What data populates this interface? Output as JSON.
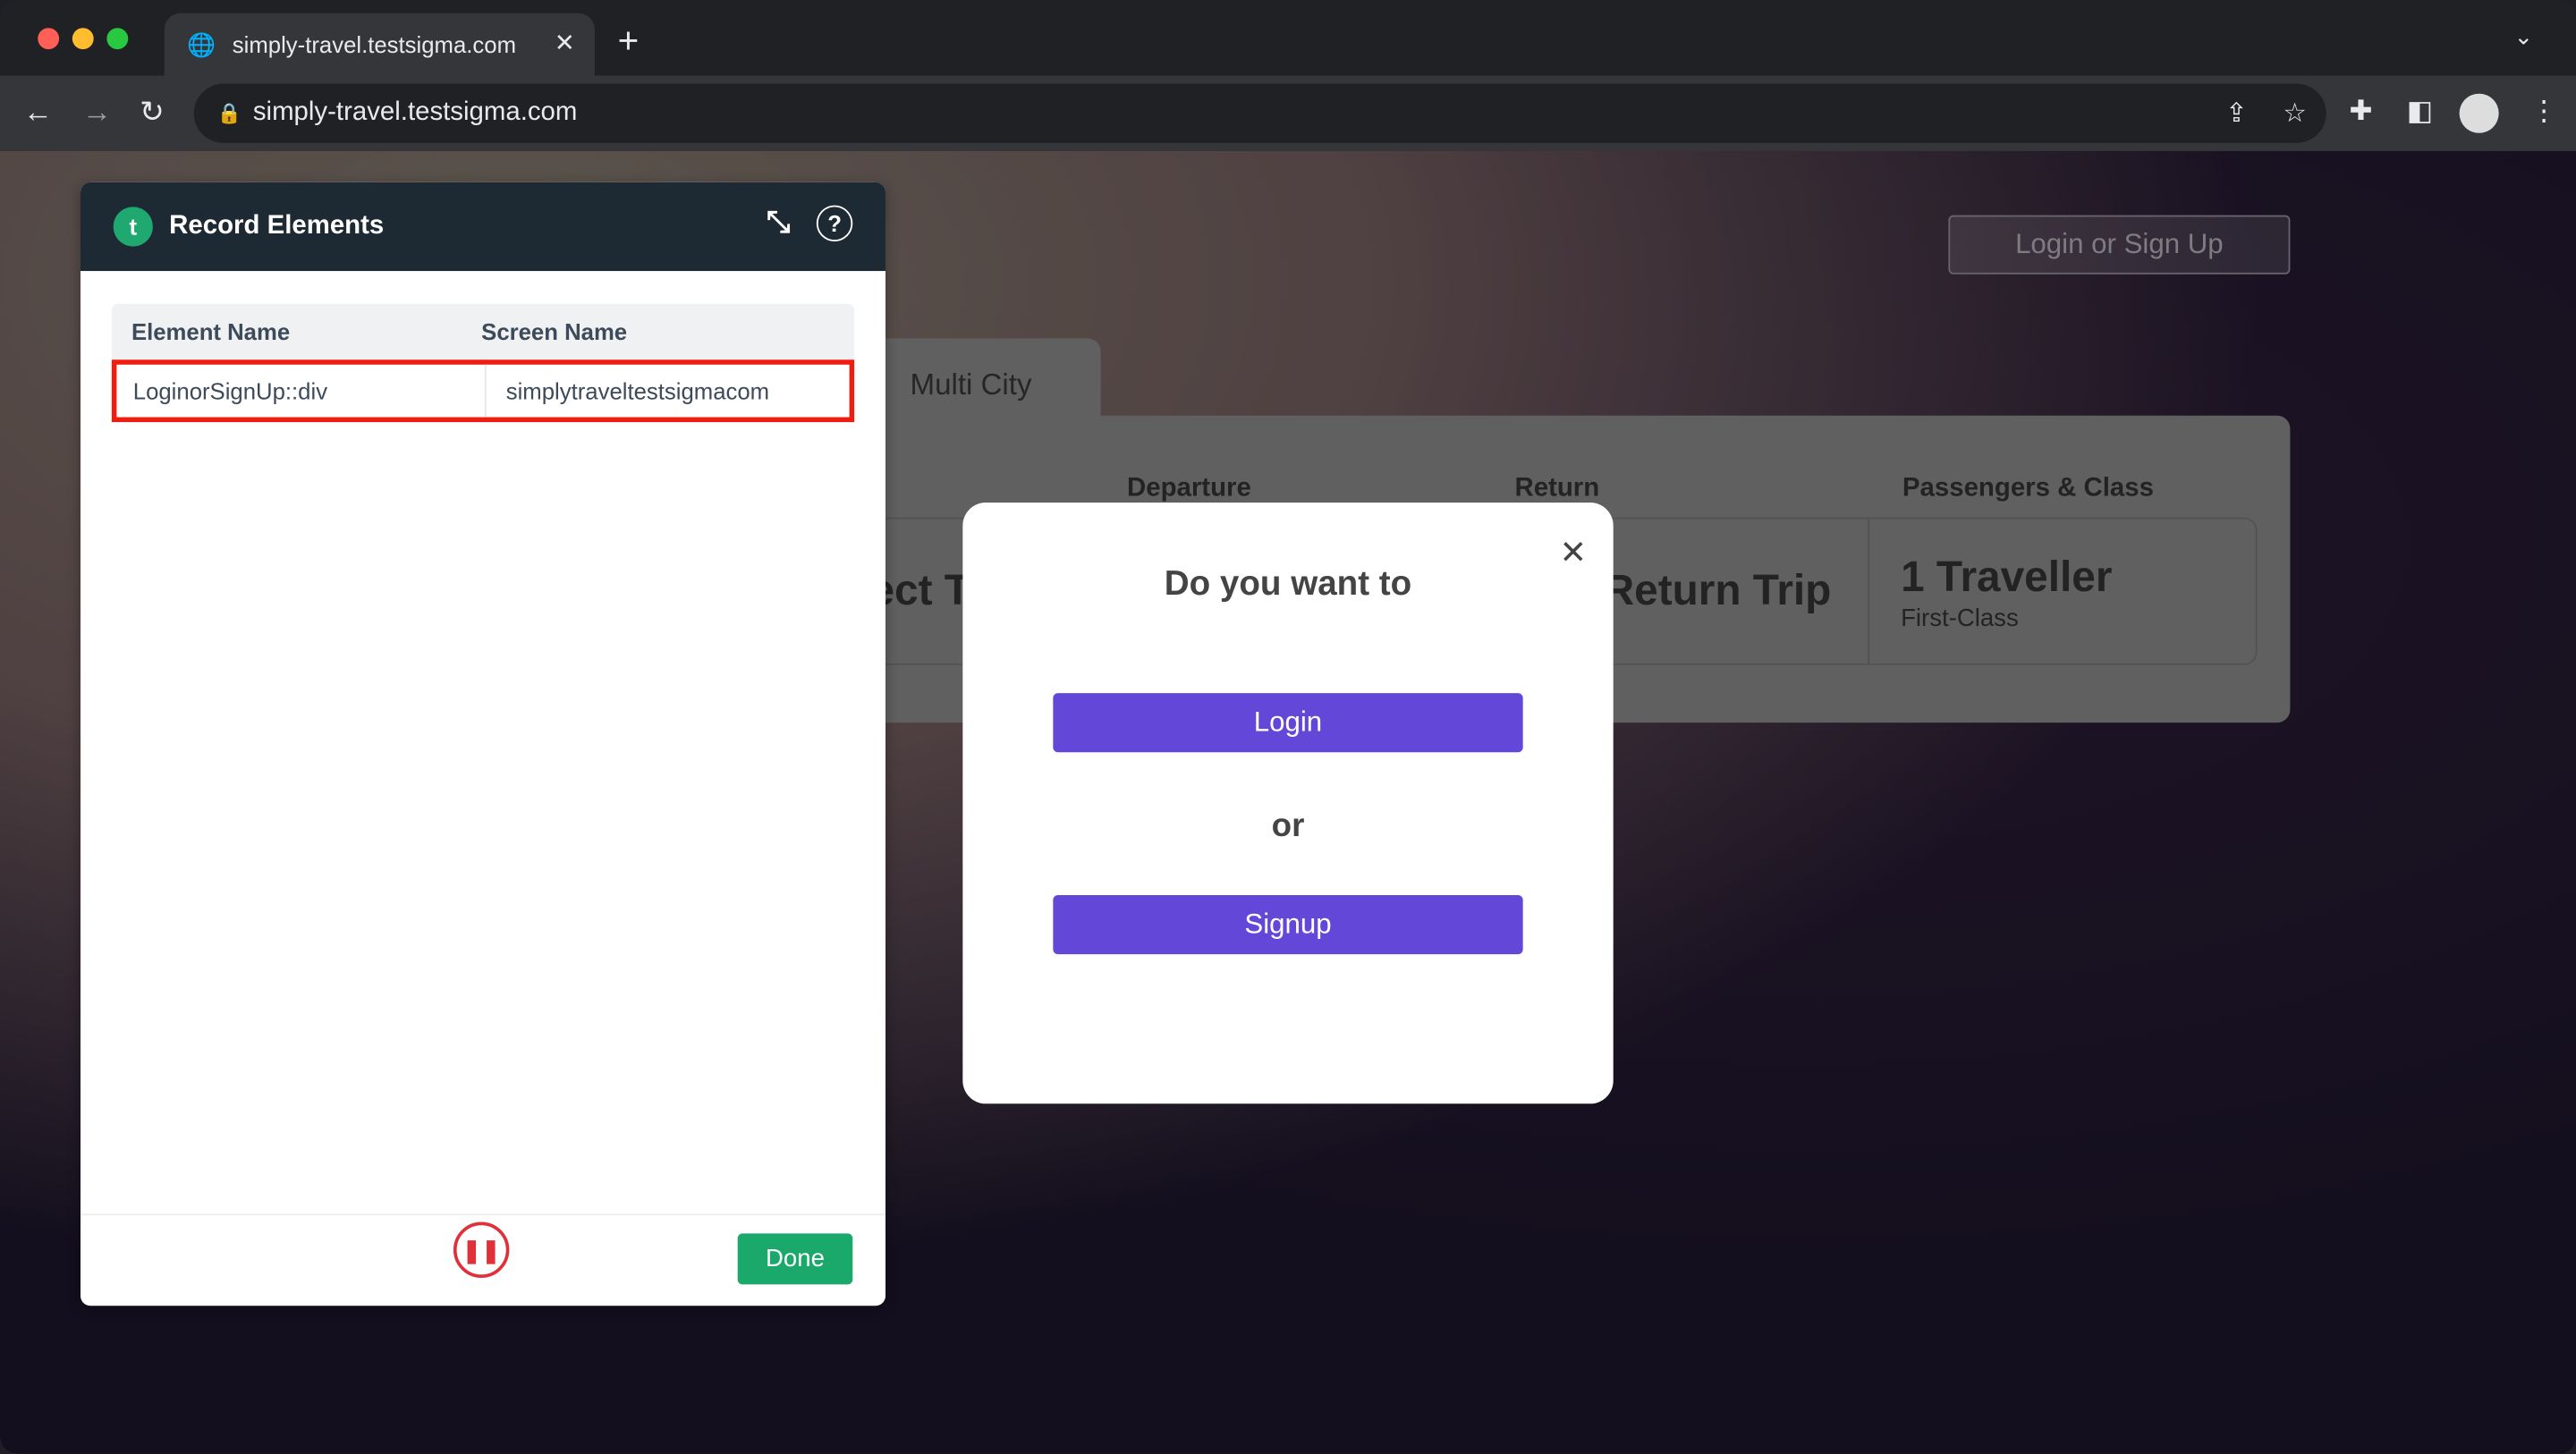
{
  "browser": {
    "tab_title": "simply-travel.testsigma.com",
    "url": "simply-travel.testsigma.com",
    "colors": {
      "close": "#ff5f57",
      "minimize": "#febc2e",
      "zoom": "#28c840"
    }
  },
  "site": {
    "login_signup": "Login or Sign Up",
    "multi_city": "Multi City",
    "labels": {
      "departure": "Departure",
      "return": "Return",
      "passengers": "Passengers & Class"
    },
    "from_partial": "ect T",
    "return_value": "Return Trip",
    "travellers": "1 Traveller",
    "class": "First-Class"
  },
  "modal": {
    "title": "Do you want to",
    "login": "Login",
    "or": "or",
    "signup": "Signup",
    "accent": "#6347d8"
  },
  "recorder": {
    "title": "Record Elements",
    "columns": [
      "Element Name",
      "Screen Name"
    ],
    "rows": [
      {
        "element": "LoginorSignUp::div",
        "screen": "simplytraveltestsigmacom"
      }
    ],
    "done": "Done",
    "accent": "#1aa96b"
  }
}
